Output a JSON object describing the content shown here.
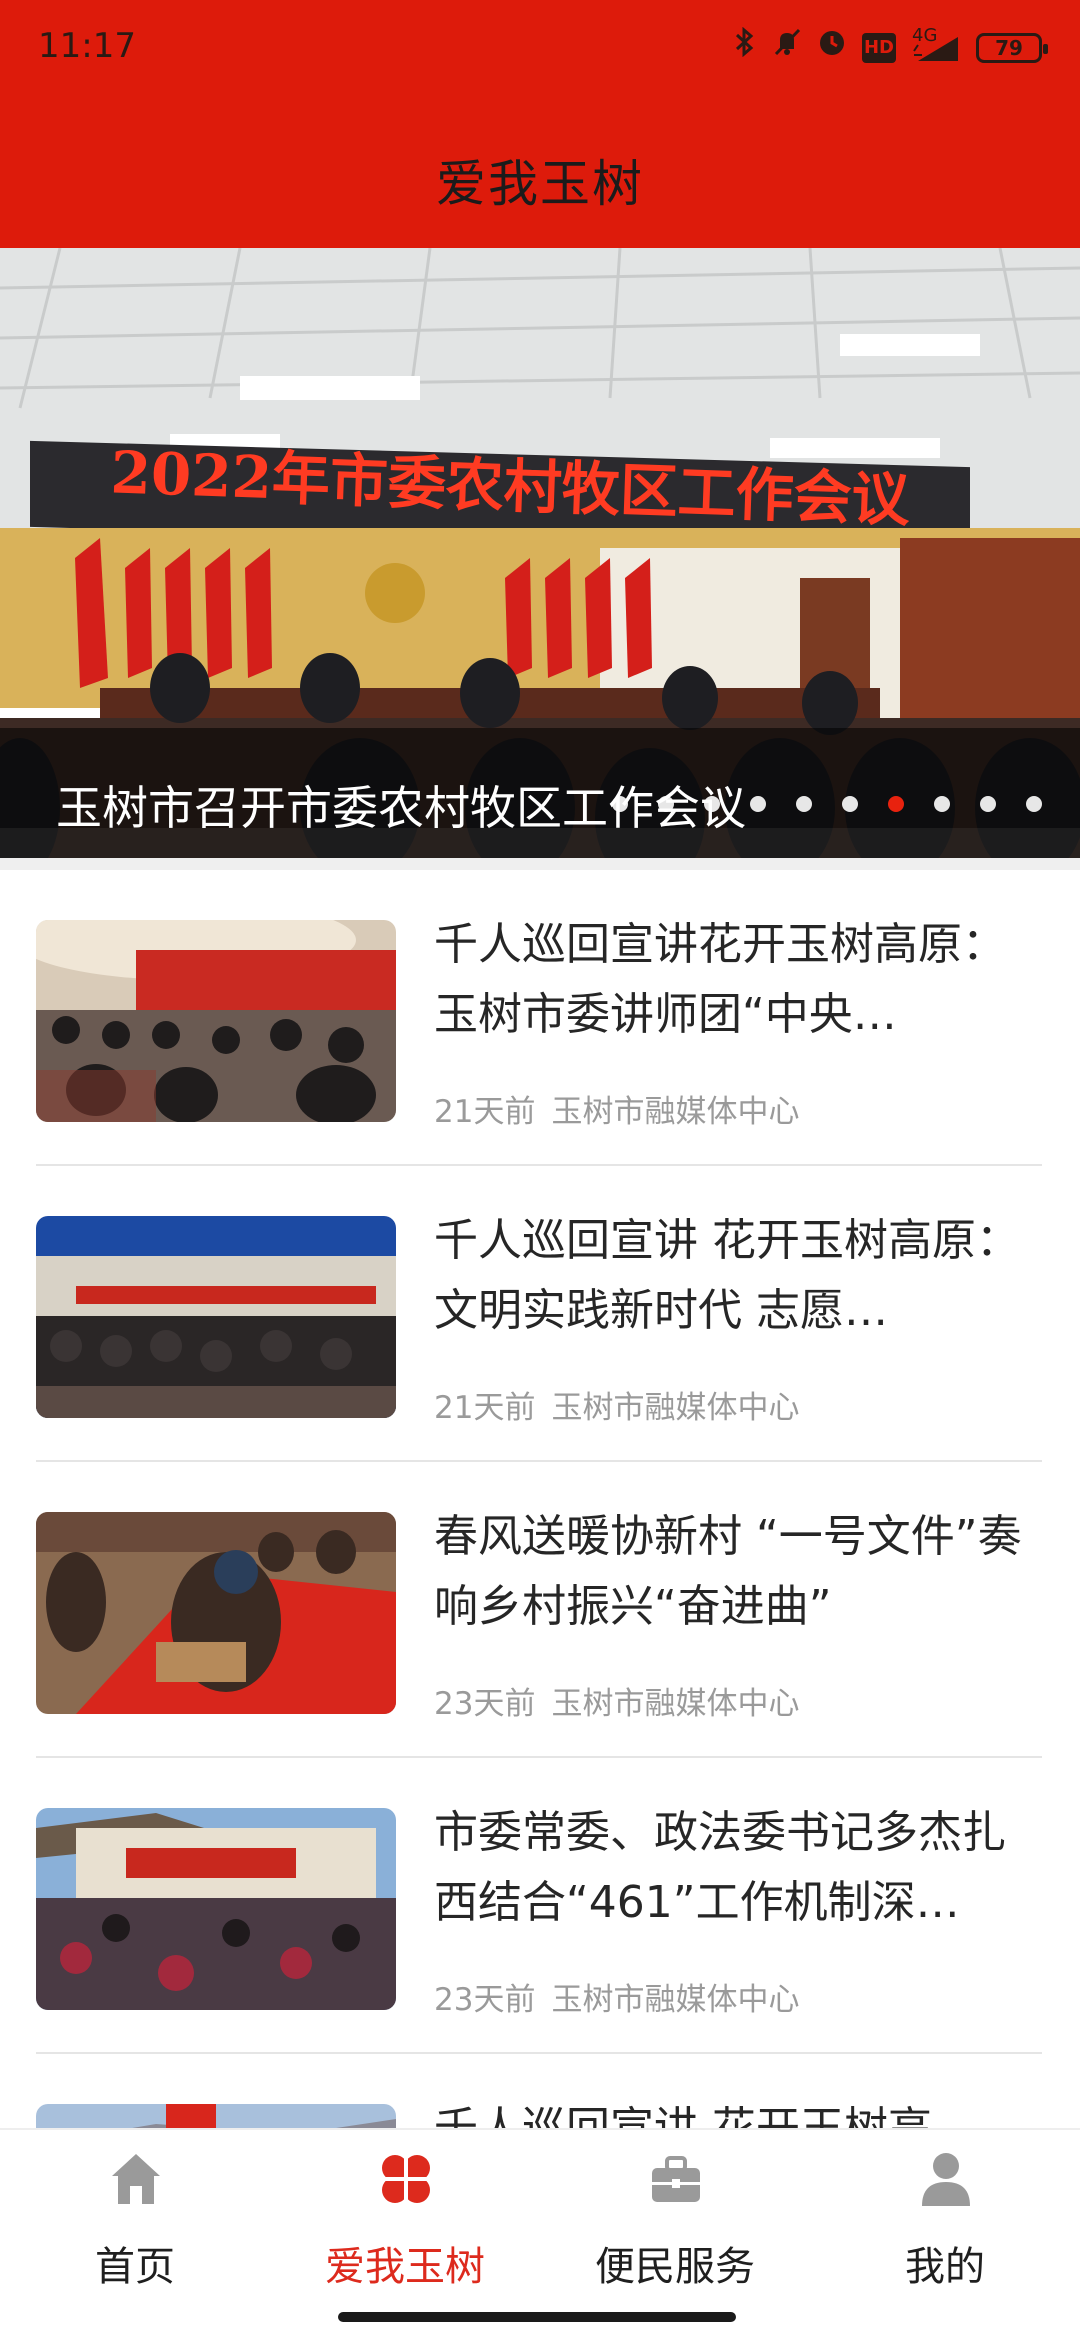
{
  "status_bar": {
    "time": "11:17",
    "network": "4G",
    "hd": "HD",
    "battery": "79"
  },
  "header": {
    "title": "爱我玉树"
  },
  "banner": {
    "caption": "玉树市召开市委农村牧区工作会议",
    "photo_banner_text": "2022年市委农村牧区工作会议",
    "slide_count": 10,
    "active_index": 6
  },
  "news": [
    {
      "title": "千人巡回宣讲花开玉树高原：玉树市委讲师团“中央…",
      "time": "21天前",
      "source": "玉树市融媒体中心"
    },
    {
      "title": "千人巡回宣讲  花开玉树高原：文明实践新时代  志愿…",
      "time": "21天前",
      "source": "玉树市融媒体中心"
    },
    {
      "title": "春风送暖协新村  “一号文件”奏响乡村振兴“奋进曲”",
      "time": "23天前",
      "source": "玉树市融媒体中心"
    },
    {
      "title": "市委常委、政法委书记多杰扎西结合“461”工作机制深…",
      "time": "23天前",
      "source": "玉树市融媒体中心"
    },
    {
      "title": "千人巡回宣讲  花开玉树高",
      "time": "",
      "source": ""
    }
  ],
  "bottom_nav": {
    "items": [
      {
        "label": "首页",
        "icon": "home-icon"
      },
      {
        "label": "爱我玉树",
        "icon": "clover-icon",
        "active": true
      },
      {
        "label": "便民服务",
        "icon": "briefcase-icon"
      },
      {
        "label": "我的",
        "icon": "person-icon"
      }
    ]
  },
  "colors": {
    "primary_red": "#dd1b0b",
    "active_nav": "#dd2a1d"
  }
}
